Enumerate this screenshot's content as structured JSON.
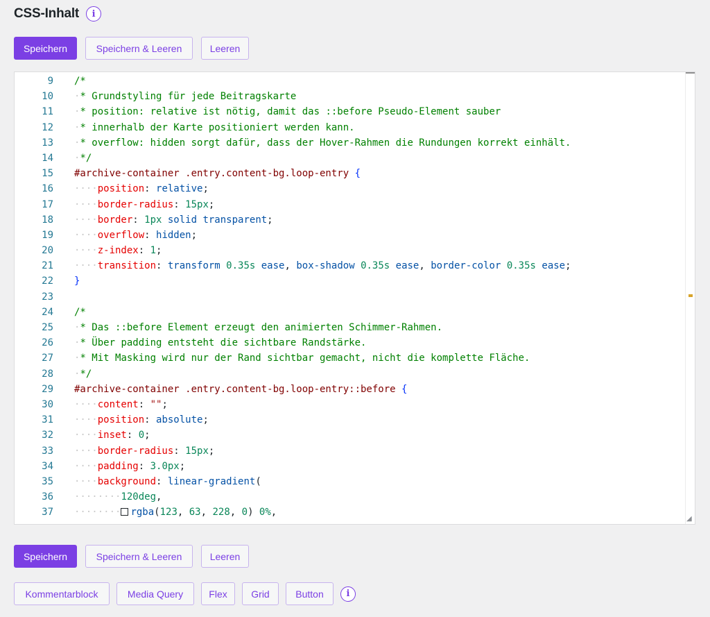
{
  "header": {
    "title": "CSS-Inhalt",
    "info_icon": "i"
  },
  "top_buttons": {
    "save": "Speichern",
    "save_clear": "Speichern & Leeren",
    "clear": "Leeren"
  },
  "bottom_buttons": {
    "save": "Speichern",
    "save_clear": "Speichern & Leeren",
    "clear": "Leeren"
  },
  "snippet_buttons": {
    "comment_block": "Kommentarblock",
    "media_query": "Media Query",
    "flex": "Flex",
    "grid": "Grid",
    "button": "Button",
    "info_icon": "i"
  },
  "editor": {
    "icons": {
      "resize": "resize-handle-icon",
      "swatch": "color-swatch-icon"
    },
    "lines": [
      {
        "n": "9",
        "t": [
          [
            "/*",
            "comment"
          ]
        ]
      },
      {
        "n": "10",
        "t": [
          [
            "·",
            "ws"
          ],
          [
            "* Grundstyling für jede Beitragskarte",
            "comment"
          ]
        ]
      },
      {
        "n": "11",
        "t": [
          [
            "·",
            "ws"
          ],
          [
            "* position: relative ist nötig, damit das ::before Pseudo-Element sauber",
            "comment"
          ]
        ]
      },
      {
        "n": "12",
        "t": [
          [
            "·",
            "ws"
          ],
          [
            "* innerhalb der Karte positioniert werden kann.",
            "comment"
          ]
        ]
      },
      {
        "n": "13",
        "t": [
          [
            "·",
            "ws"
          ],
          [
            "* overflow: hidden sorgt dafür, dass der Hover-Rahmen die Rundungen korrekt einhält.",
            "comment"
          ]
        ]
      },
      {
        "n": "14",
        "t": [
          [
            "·",
            "ws"
          ],
          [
            "*/",
            "comment"
          ]
        ]
      },
      {
        "n": "15",
        "t": [
          [
            "#archive-container .entry.content-bg.loop-entry ",
            "selector"
          ],
          [
            "{",
            "brace"
          ]
        ]
      },
      {
        "n": "16",
        "t": [
          [
            "····",
            "ws"
          ],
          [
            "position",
            "prop"
          ],
          [
            ": ",
            "punct"
          ],
          [
            "relative",
            "val"
          ],
          [
            ";",
            "punct"
          ]
        ]
      },
      {
        "n": "17",
        "t": [
          [
            "····",
            "ws"
          ],
          [
            "border-radius",
            "prop"
          ],
          [
            ": ",
            "punct"
          ],
          [
            "15px",
            "num"
          ],
          [
            ";",
            "punct"
          ]
        ]
      },
      {
        "n": "18",
        "t": [
          [
            "····",
            "ws"
          ],
          [
            "border",
            "prop"
          ],
          [
            ": ",
            "punct"
          ],
          [
            "1px",
            "num"
          ],
          [
            " solid transparent",
            "val"
          ],
          [
            ";",
            "punct"
          ]
        ]
      },
      {
        "n": "19",
        "t": [
          [
            "····",
            "ws"
          ],
          [
            "overflow",
            "prop"
          ],
          [
            ": ",
            "punct"
          ],
          [
            "hidden",
            "val"
          ],
          [
            ";",
            "punct"
          ]
        ]
      },
      {
        "n": "20",
        "t": [
          [
            "····",
            "ws"
          ],
          [
            "z-index",
            "prop"
          ],
          [
            ": ",
            "punct"
          ],
          [
            "1",
            "num"
          ],
          [
            ";",
            "punct"
          ]
        ]
      },
      {
        "n": "21",
        "t": [
          [
            "····",
            "ws"
          ],
          [
            "transition",
            "prop"
          ],
          [
            ": ",
            "punct"
          ],
          [
            "transform ",
            "val"
          ],
          [
            "0.35s",
            "num"
          ],
          [
            " ease",
            "val"
          ],
          [
            ", ",
            "punct"
          ],
          [
            "box-shadow ",
            "val"
          ],
          [
            "0.35s",
            "num"
          ],
          [
            " ease",
            "val"
          ],
          [
            ", ",
            "punct"
          ],
          [
            "border-color ",
            "val"
          ],
          [
            "0.35s",
            "num"
          ],
          [
            " ease",
            "val"
          ],
          [
            ";",
            "punct"
          ]
        ]
      },
      {
        "n": "22",
        "t": [
          [
            "}",
            "brace"
          ]
        ]
      },
      {
        "n": "23",
        "t": []
      },
      {
        "n": "24",
        "t": [
          [
            "/*",
            "comment"
          ]
        ]
      },
      {
        "n": "25",
        "t": [
          [
            "·",
            "ws"
          ],
          [
            "* Das ::before Element erzeugt den animierten Schimmer-Rahmen.",
            "comment"
          ]
        ]
      },
      {
        "n": "26",
        "t": [
          [
            "·",
            "ws"
          ],
          [
            "* Über padding entsteht die sichtbare Randstärke.",
            "comment"
          ]
        ]
      },
      {
        "n": "27",
        "t": [
          [
            "·",
            "ws"
          ],
          [
            "* Mit Masking wird nur der Rand sichtbar gemacht, nicht die komplette Fläche.",
            "comment"
          ]
        ]
      },
      {
        "n": "28",
        "t": [
          [
            "·",
            "ws"
          ],
          [
            "*/",
            "comment"
          ]
        ]
      },
      {
        "n": "29",
        "t": [
          [
            "#archive-container .entry.content-bg.loop-entry::before ",
            "selector"
          ],
          [
            "{",
            "brace"
          ]
        ]
      },
      {
        "n": "30",
        "t": [
          [
            "····",
            "ws"
          ],
          [
            "content",
            "prop"
          ],
          [
            ": ",
            "punct"
          ],
          [
            "\"\"",
            "str"
          ],
          [
            ";",
            "punct"
          ]
        ]
      },
      {
        "n": "31",
        "t": [
          [
            "····",
            "ws"
          ],
          [
            "position",
            "prop"
          ],
          [
            ": ",
            "punct"
          ],
          [
            "absolute",
            "val"
          ],
          [
            ";",
            "punct"
          ]
        ]
      },
      {
        "n": "32",
        "t": [
          [
            "····",
            "ws"
          ],
          [
            "inset",
            "prop"
          ],
          [
            ": ",
            "punct"
          ],
          [
            "0",
            "num"
          ],
          [
            ";",
            "punct"
          ]
        ]
      },
      {
        "n": "33",
        "t": [
          [
            "····",
            "ws"
          ],
          [
            "border-radius",
            "prop"
          ],
          [
            ": ",
            "punct"
          ],
          [
            "15px",
            "num"
          ],
          [
            ";",
            "punct"
          ]
        ]
      },
      {
        "n": "34",
        "t": [
          [
            "····",
            "ws"
          ],
          [
            "padding",
            "prop"
          ],
          [
            ": ",
            "punct"
          ],
          [
            "3.0px",
            "num"
          ],
          [
            ";",
            "punct"
          ]
        ]
      },
      {
        "n": "35",
        "t": [
          [
            "····",
            "ws"
          ],
          [
            "background",
            "prop"
          ],
          [
            ": ",
            "punct"
          ],
          [
            "linear-gradient",
            "val"
          ],
          [
            "(",
            "punct"
          ]
        ]
      },
      {
        "n": "36",
        "t": [
          [
            "········",
            "ws"
          ],
          [
            "120deg",
            "num"
          ],
          [
            ",",
            "punct"
          ]
        ]
      },
      {
        "n": "37",
        "t": [
          [
            "········",
            "ws"
          ],
          [
            "SWATCH",
            "swatch"
          ],
          [
            "rgba",
            "val"
          ],
          [
            "(",
            "punct"
          ],
          [
            "123",
            "num"
          ],
          [
            ", ",
            "punct"
          ],
          [
            "63",
            "num"
          ],
          [
            ", ",
            "punct"
          ],
          [
            "228",
            "num"
          ],
          [
            ", ",
            "punct"
          ],
          [
            "0",
            "num"
          ],
          [
            ") ",
            "punct"
          ],
          [
            "0%",
            "num"
          ],
          [
            ",",
            "punct"
          ]
        ]
      }
    ]
  }
}
